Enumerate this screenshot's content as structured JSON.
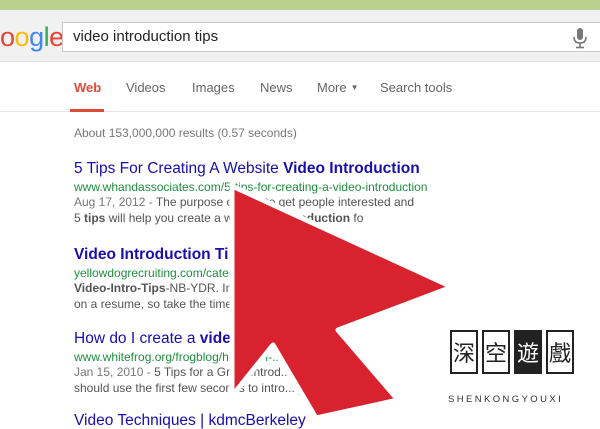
{
  "search": {
    "logo": "oogle",
    "query": "video introduction tips"
  },
  "tabs": [
    {
      "label": "Web"
    },
    {
      "label": "Videos"
    },
    {
      "label": "Images"
    },
    {
      "label": "News"
    },
    {
      "label": "More"
    },
    {
      "label": "Search tools"
    }
  ],
  "stats": "About 153,000,000 results (0.57 seconds)",
  "results": [
    {
      "title_a": "5 Tips For Creating A Website ",
      "title_b": "Video Introduction",
      "url": "www.whandassociates.com/5-tips-for-creating-a-video-introduction",
      "snip1_date": "Aug 17, 2012 - ",
      "snip1": "The purpose of ... is to get people interested and",
      "snip2_a": "5 ",
      "snip2_b": "tips",
      "snip2_c": " will help you create a wi...",
      "snip2_d": "video introduction",
      "snip2_e": " fo"
    },
    {
      "title_a": "",
      "title_b": "Video Introduction Tips",
      "title_c": " ... Recruiting",
      "url": "yellowdogrecruiting.com/category...",
      "snip1_b": "Video-Intro-Tips",
      "snip1": "-NB-YDR. Insert text to ... do not show",
      "snip2_c": "on a resume, so take the time to thi...  ... want to ..."
    },
    {
      "title_a": "How do I create a ",
      "title_b": "video intro",
      "title_c": " ... frog",
      "url": "www.whitefrog.org/frogblog/how-do-i-...",
      "snip1_date": "Jan 15, 2010 - ",
      "snip1": "5 Tips for a Great Introd... video:  1",
      "snip2_c": "should use the first few seconds to intro... yourself an"
    },
    {
      "title_a": "Video Techniques | kdmcBerkeley",
      "title_b": "",
      "url": ""
    }
  ],
  "watermark": {
    "chars": [
      "深",
      "空",
      "遊",
      "戲"
    ],
    "latin": "SHENKONGYOUXI"
  },
  "colors": {
    "link": "#1a0dab",
    "url": "#1e8e3e",
    "tab_active": "#dd4b39",
    "arrow": "#d8232f"
  }
}
